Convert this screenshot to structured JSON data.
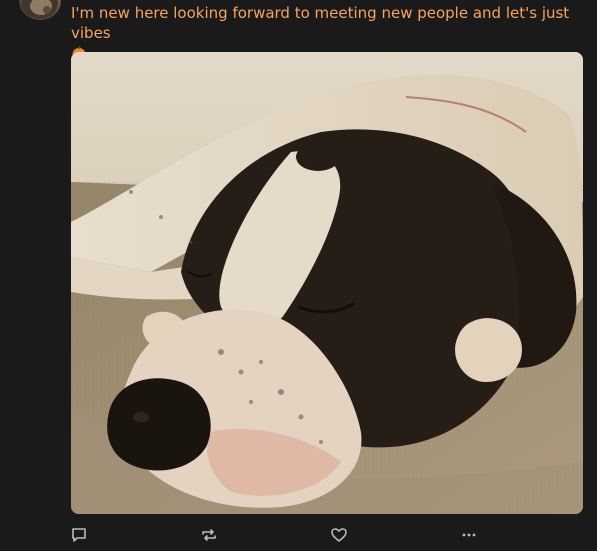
{
  "post": {
    "text": "I'm new here looking forward to meeting new people and let's just vibes",
    "emoji": "jack-o-lantern",
    "text_color": "#f6a45f",
    "media": {
      "alt": "sleeping dog photo"
    }
  },
  "actions": [
    {
      "icon": "reply-icon"
    },
    {
      "icon": "repost-icon"
    },
    {
      "icon": "like-icon"
    },
    {
      "icon": "more-icon"
    }
  ],
  "colors": {
    "background": "#1a1a1a",
    "icon": "#b8bcc6"
  }
}
